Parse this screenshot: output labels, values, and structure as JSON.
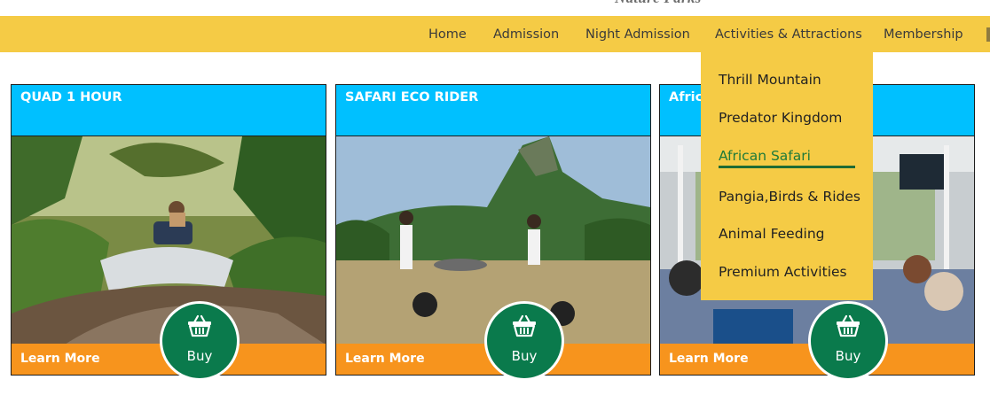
{
  "header": {
    "logo_text": "Nature Parks"
  },
  "nav": {
    "items": [
      {
        "label": "Home"
      },
      {
        "label": "Admission"
      },
      {
        "label": "Night Admission"
      },
      {
        "label": "Activities & Attractions"
      },
      {
        "label": "Membership"
      }
    ]
  },
  "dropdown": {
    "items": [
      {
        "label": "Thrill Mountain",
        "active": false
      },
      {
        "label": "Predator Kingdom",
        "active": false
      },
      {
        "label": "African Safari",
        "active": true
      },
      {
        "label": "Pangia,Birds & Rides",
        "active": false
      },
      {
        "label": "Animal Feeding",
        "active": false
      },
      {
        "label": "Premium Activities",
        "active": false
      }
    ]
  },
  "cards": [
    {
      "title": "QUAD 1 HOUR",
      "learn_more": "Learn More",
      "buy": "Buy",
      "image": "quad-bike-through-water"
    },
    {
      "title": "SAFARI ECO RIDER",
      "learn_more": "Learn More",
      "buy": "Buy",
      "image": "segway-riders-with-zebras"
    },
    {
      "title": "Africa",
      "learn_more": "Learn More",
      "buy": "Buy",
      "image": "safari-bus-passengers"
    }
  ],
  "colors": {
    "nav_bg": "#f5cb45",
    "card_header": "#00c0ff",
    "card_footer": "#f7941d",
    "buy_button": "#0a7a4c",
    "active_link": "#1f7a3a"
  },
  "icons": [
    "basket-icon"
  ]
}
